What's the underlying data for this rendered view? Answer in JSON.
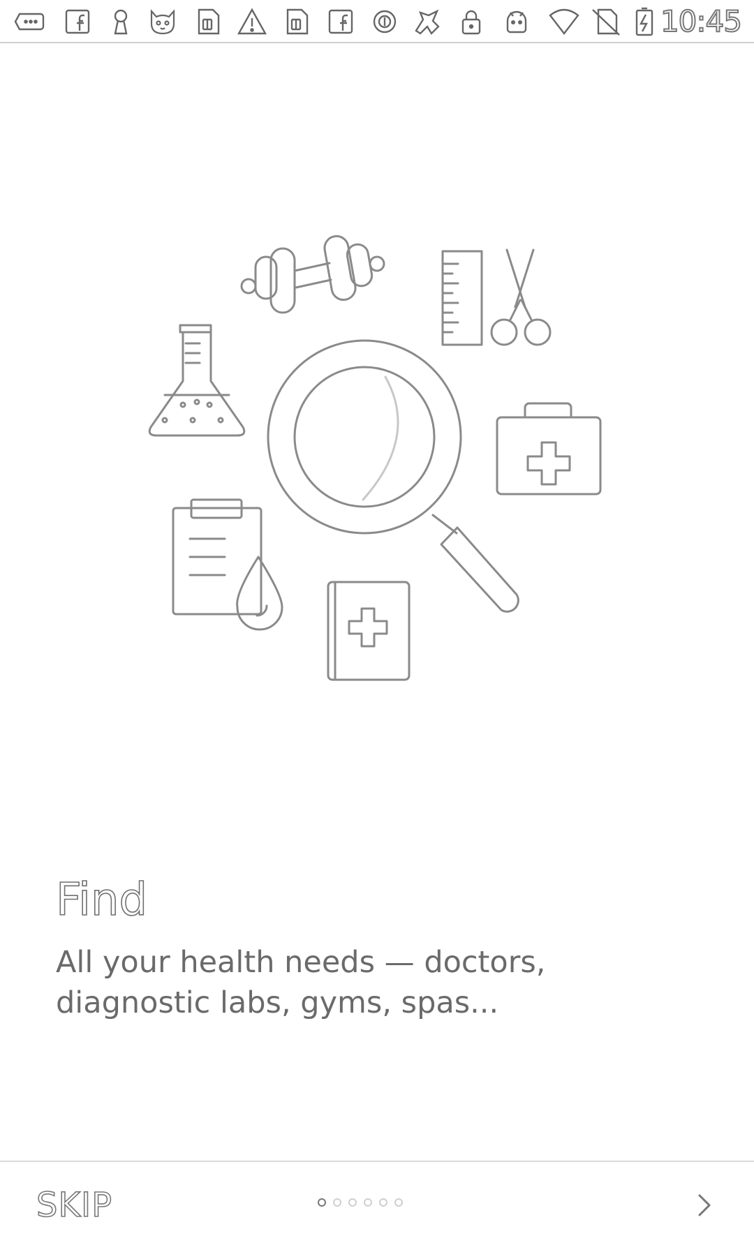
{
  "status_bar": {
    "time": "10:45",
    "icons": [
      "messenger-chat-icon",
      "facebook-icon",
      "keyhole-icon",
      "cat-face-icon",
      "sim-card-icon",
      "warning-icon",
      "sim-card-icon",
      "facebook-icon",
      "circle-icon",
      "horse-icon",
      "lock-icon",
      "android-icon",
      "wifi-icon",
      "no-sim-icon",
      "battery-charging-icon"
    ]
  },
  "illustration": {
    "items": [
      "dumbbell-icon",
      "ruler-icon",
      "scissors-icon",
      "flask-icon",
      "magnifying-glass-icon",
      "first-aid-kit-icon",
      "clipboard-icon",
      "blood-drop-icon",
      "medical-book-icon"
    ]
  },
  "onboarding": {
    "title": "Find",
    "description": "All your health needs — doctors, diagnostic labs, gyms, spas..."
  },
  "navigation": {
    "skip_label": "SKIP",
    "page_count": 6,
    "current_page": 1,
    "next_icon": "chevron-right-icon"
  }
}
